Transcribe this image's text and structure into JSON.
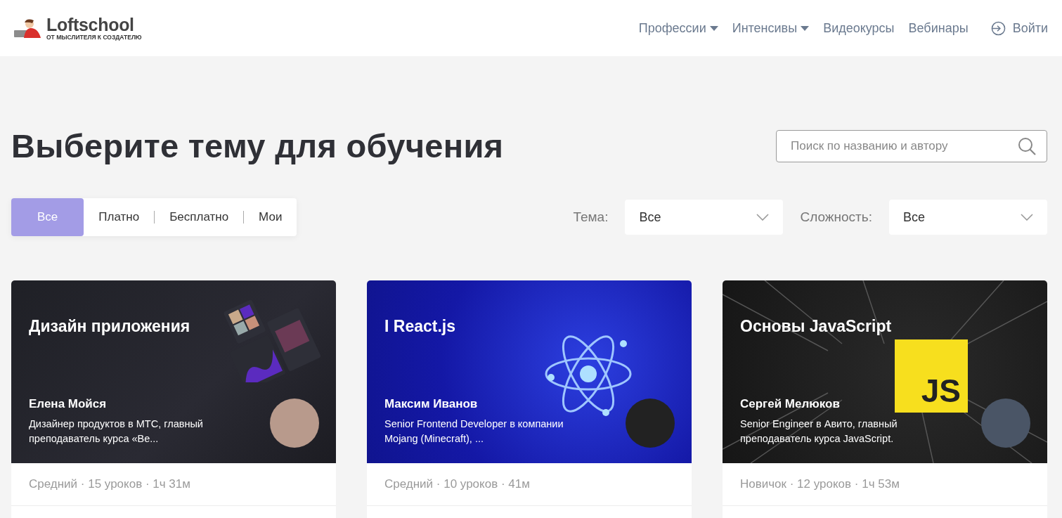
{
  "header": {
    "logo": {
      "name": "Loftschool",
      "tagline": "ОТ МЫСЛИТЕЛЯ К СОЗДАТЕЛЮ"
    },
    "nav": [
      {
        "label": "Профессии",
        "has_menu": true
      },
      {
        "label": "Интенсивы",
        "has_menu": true
      },
      {
        "label": "Видеокурсы",
        "has_menu": false
      },
      {
        "label": "Вебинары",
        "has_menu": false
      }
    ],
    "login": "Войти"
  },
  "heading": "Выберите тему для обучения",
  "search": {
    "placeholder": "Поиск по названию и автору"
  },
  "tabs": [
    {
      "label": "Все",
      "selected": true
    },
    {
      "label": "Платно",
      "selected": false
    },
    {
      "label": "Бесплатно",
      "selected": false
    },
    {
      "label": "Мои",
      "selected": false
    }
  ],
  "filters": [
    {
      "label": "Тема:",
      "value": "Все"
    },
    {
      "label": "Сложность:",
      "value": "Все"
    }
  ],
  "courses": [
    {
      "kind": "design",
      "title": "Дизайн приложения",
      "author": "Елена Мойся",
      "bio": "Дизайнер продуктов в МТС, главный преподаватель курса «Ве...",
      "meta": "Средний · 15 уроков · 1ч 31м"
    },
    {
      "kind": "react",
      "title": "I React.js",
      "author": "Максим Иванов",
      "bio": "Senior Frontend Developer в компании Mojang (Minecraft), ...",
      "meta": "Средний · 10 уроков · 41м"
    },
    {
      "kind": "js",
      "title": "Основы JavaScript",
      "author": "Сергей Мелюков",
      "bio": "Senior Engineer в Авито, главный преподаватель курса JavaScript.",
      "meta": "Новичок · 12 уроков · 1ч 53м",
      "badge": "JS"
    }
  ]
}
